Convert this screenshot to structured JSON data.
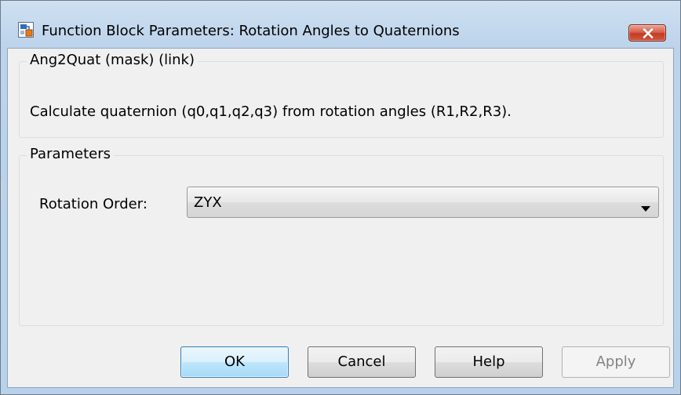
{
  "window": {
    "title": "Function Block Parameters: Rotation Angles to Quaternions",
    "close_icon": "close-icon"
  },
  "mask_group": {
    "legend": "Ang2Quat (mask) (link)",
    "description": "Calculate quaternion (q0,q1,q2,q3) from rotation angles (R1,R2,R3)."
  },
  "parameters_group": {
    "legend": "Parameters",
    "rotation_order": {
      "label": "Rotation Order:",
      "value": "ZYX"
    }
  },
  "buttons": {
    "ok": "OK",
    "cancel": "Cancel",
    "help": "Help",
    "apply": "Apply"
  }
}
